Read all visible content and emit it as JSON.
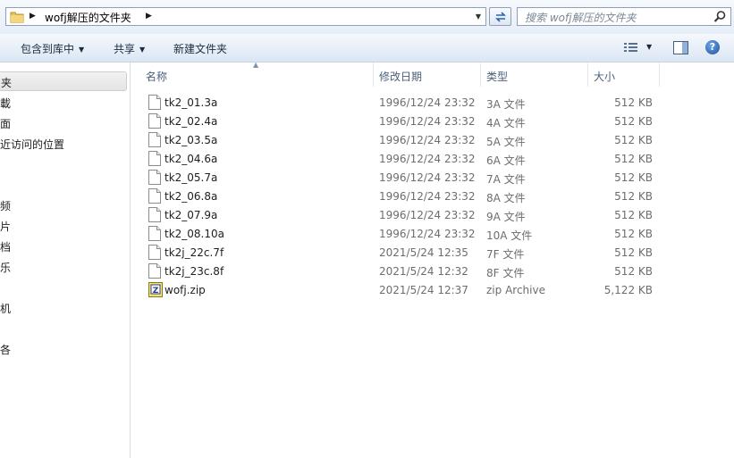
{
  "address": {
    "path_folder": "wofj解压的文件夹"
  },
  "search": {
    "placeholder": "搜索 wofj解压的文件夹"
  },
  "toolbar": {
    "include_label": "包含到库中",
    "share_label": "共享",
    "new_folder_label": "新建文件夹"
  },
  "nav": {
    "items": [
      {
        "label": "夹"
      },
      {
        "label": "載"
      },
      {
        "label": "面"
      },
      {
        "label": "近访问的位置"
      },
      {
        "label": "频"
      },
      {
        "label": "片"
      },
      {
        "label": "档"
      },
      {
        "label": "乐"
      },
      {
        "label": "机"
      },
      {
        "label": "各"
      }
    ]
  },
  "columns": {
    "name": "名称",
    "modified": "修改日期",
    "type": "类型",
    "size": "大小"
  },
  "files": [
    {
      "name": "tk2_01.3a",
      "modified": "1996/12/24 23:32",
      "type": "3A 文件",
      "size": "512 KB",
      "icon": "file-icon"
    },
    {
      "name": "tk2_02.4a",
      "modified": "1996/12/24 23:32",
      "type": "4A 文件",
      "size": "512 KB",
      "icon": "file-icon"
    },
    {
      "name": "tk2_03.5a",
      "modified": "1996/12/24 23:32",
      "type": "5A 文件",
      "size": "512 KB",
      "icon": "file-icon"
    },
    {
      "name": "tk2_04.6a",
      "modified": "1996/12/24 23:32",
      "type": "6A 文件",
      "size": "512 KB",
      "icon": "file-icon"
    },
    {
      "name": "tk2_05.7a",
      "modified": "1996/12/24 23:32",
      "type": "7A 文件",
      "size": "512 KB",
      "icon": "file-icon"
    },
    {
      "name": "tk2_06.8a",
      "modified": "1996/12/24 23:32",
      "type": "8A 文件",
      "size": "512 KB",
      "icon": "file-icon"
    },
    {
      "name": "tk2_07.9a",
      "modified": "1996/12/24 23:32",
      "type": "9A 文件",
      "size": "512 KB",
      "icon": "file-icon"
    },
    {
      "name": "tk2_08.10a",
      "modified": "1996/12/24 23:32",
      "type": "10A 文件",
      "size": "512 KB",
      "icon": "file-icon"
    },
    {
      "name": "tk2j_22c.7f",
      "modified": "2021/5/24 12:35",
      "type": "7F 文件",
      "size": "512 KB",
      "icon": "file-icon"
    },
    {
      "name": "tk2j_23c.8f",
      "modified": "2021/5/24 12:32",
      "type": "8F 文件",
      "size": "512 KB",
      "icon": "file-icon"
    },
    {
      "name": "wofj.zip",
      "modified": "2021/5/24 12:37",
      "type": "zip Archive",
      "size": "5,122 KB",
      "icon": "zip-archive-icon"
    }
  ]
}
